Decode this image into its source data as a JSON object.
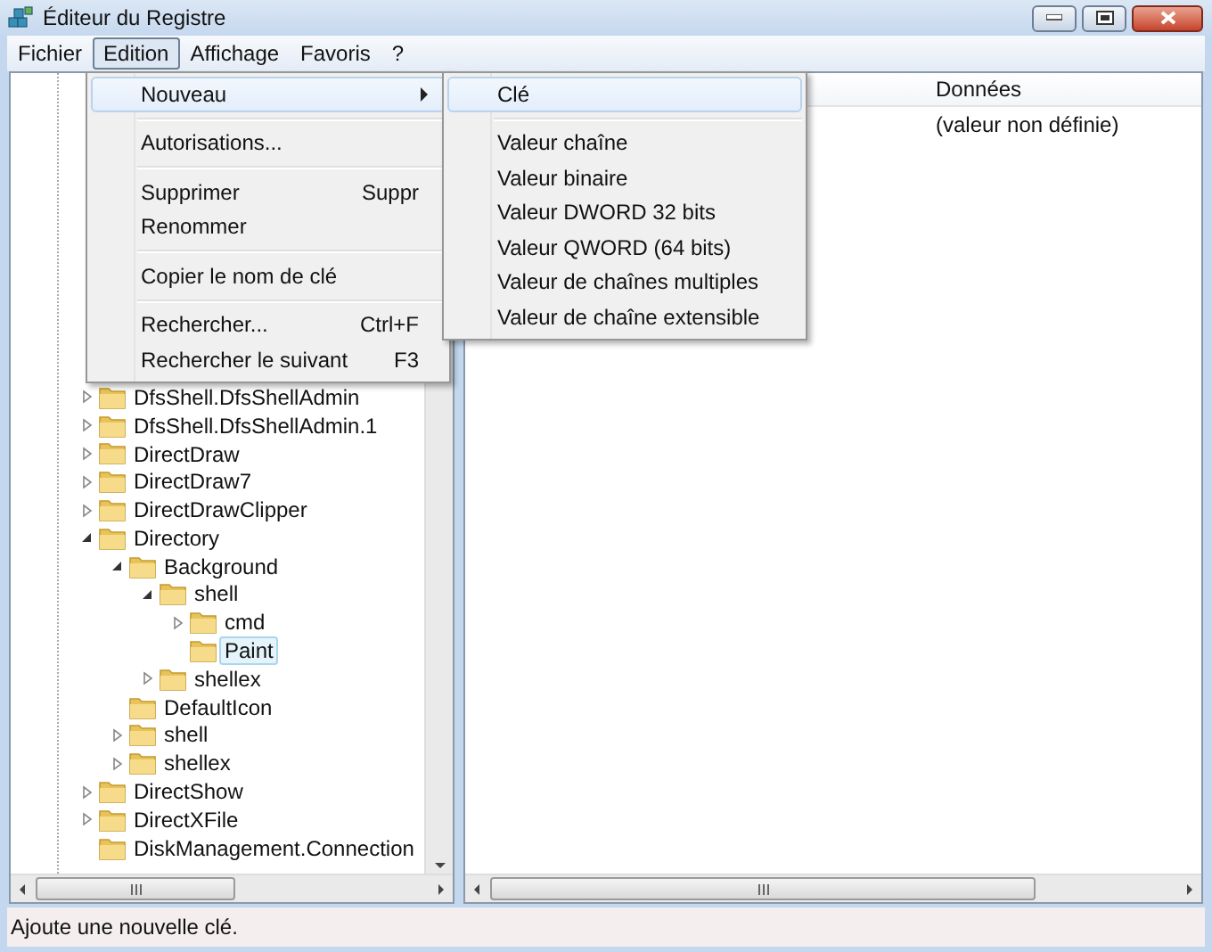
{
  "window": {
    "title": "Éditeur du Registre"
  },
  "menu_bar": [
    {
      "label": "Fichier",
      "selected": false
    },
    {
      "label": "Edition",
      "selected": true
    },
    {
      "label": "Affichage",
      "selected": false
    },
    {
      "label": "Favoris",
      "selected": false
    },
    {
      "label": "?",
      "selected": false
    }
  ],
  "edit_menu": {
    "items": [
      {
        "kind": "item",
        "label": "Nouveau",
        "submenu": true,
        "highlighted": true
      },
      {
        "kind": "separator"
      },
      {
        "kind": "item",
        "label": "Autorisations...",
        "submenu": false,
        "highlighted": false
      },
      {
        "kind": "separator"
      },
      {
        "kind": "item",
        "label": "Supprimer",
        "shortcut": "Suppr",
        "submenu": false,
        "highlighted": false
      },
      {
        "kind": "item",
        "label": "Renommer",
        "submenu": false,
        "highlighted": false
      },
      {
        "kind": "separator"
      },
      {
        "kind": "item",
        "label": "Copier le nom de clé",
        "submenu": false,
        "highlighted": false
      },
      {
        "kind": "separator"
      },
      {
        "kind": "item",
        "label": "Rechercher...",
        "shortcut": "Ctrl+F",
        "submenu": false,
        "highlighted": false
      },
      {
        "kind": "item",
        "label": "Rechercher le suivant",
        "shortcut": "F3",
        "submenu": false,
        "highlighted": false
      }
    ]
  },
  "new_submenu": {
    "items": [
      {
        "kind": "item",
        "label": "Clé",
        "highlighted": true
      },
      {
        "kind": "separator"
      },
      {
        "kind": "item",
        "label": "Valeur chaîne",
        "highlighted": false
      },
      {
        "kind": "item",
        "label": "Valeur binaire",
        "highlighted": false
      },
      {
        "kind": "item",
        "label": "Valeur DWORD 32 bits",
        "highlighted": false
      },
      {
        "kind": "item",
        "label": "Valeur QWORD (64 bits)",
        "highlighted": false
      },
      {
        "kind": "item",
        "label": "Valeur de chaînes multiples",
        "highlighted": false
      },
      {
        "kind": "item",
        "label": "Valeur de chaîne extensible",
        "highlighted": false
      }
    ]
  },
  "tree": {
    "items": [
      {
        "label": "DfsShell.DfsShellAdmin",
        "expanded": false,
        "selected": false
      },
      {
        "label": "DfsShell.DfsShellAdmin.1",
        "expanded": false,
        "selected": false
      },
      {
        "label": "DirectDraw",
        "expanded": false,
        "selected": false
      },
      {
        "label": "DirectDraw7",
        "expanded": false,
        "selected": false
      },
      {
        "label": "DirectDrawClipper",
        "expanded": false,
        "selected": false
      },
      {
        "label": "Directory",
        "expanded": true,
        "selected": false,
        "children": [
          {
            "label": "Background",
            "expanded": true,
            "selected": false,
            "children": [
              {
                "label": "shell",
                "expanded": true,
                "selected": false,
                "children": [
                  {
                    "label": "cmd",
                    "expanded": false,
                    "selected": false
                  },
                  {
                    "label": "Paint",
                    "selected": true
                  }
                ]
              },
              {
                "label": "shellex",
                "expanded": false,
                "selected": false
              }
            ]
          },
          {
            "label": "DefaultIcon",
            "selected": false
          },
          {
            "label": "shell",
            "expanded": false,
            "selected": false
          },
          {
            "label": "shellex",
            "expanded": false,
            "selected": false
          }
        ]
      },
      {
        "label": "DirectShow",
        "expanded": false,
        "selected": false
      },
      {
        "label": "DirectXFile",
        "expanded": false,
        "selected": false
      },
      {
        "label": "DiskManagement.Connection",
        "selected": false
      }
    ]
  },
  "values_panel": {
    "columns": [
      {
        "label": "Données"
      }
    ],
    "rows": [
      {
        "data": "(valeur non définie)"
      }
    ]
  },
  "status_bar": "Ajoute une nouvelle clé."
}
